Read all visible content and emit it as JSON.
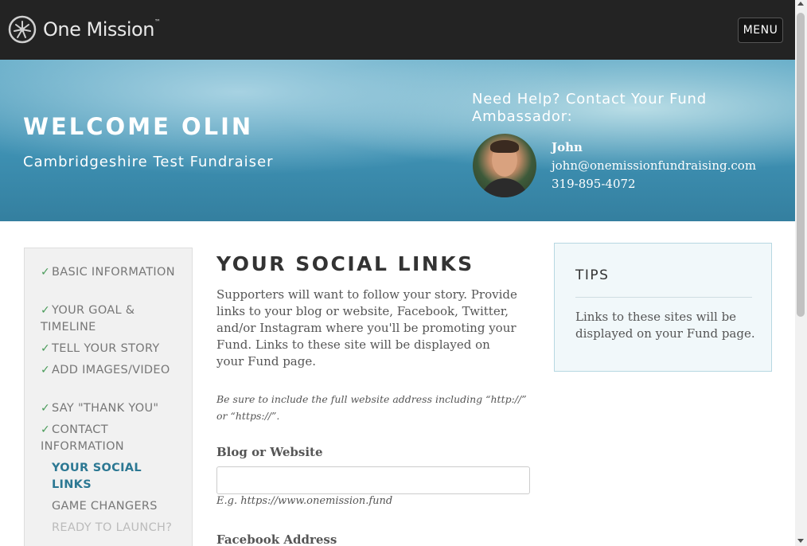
{
  "header": {
    "logo_text": "One Mission",
    "logo_tm": "™",
    "logo_icon": "tree-of-life-icon",
    "menu_label": "MENU"
  },
  "hero": {
    "welcome": "WELCOME OLIN",
    "campaign": "Cambridgeshire Test Fundraiser",
    "help_title": "Need Help? Contact Your Fund Ambassador:",
    "ambassador": {
      "name": "John",
      "email": "john@onemissionfundraising.com",
      "phone": "319-895-4072"
    }
  },
  "sidebar": {
    "steps": [
      {
        "label": "BASIC INFORMATION",
        "status": "done"
      },
      {
        "label": "YOUR GOAL & TIMELINE",
        "status": "done"
      },
      {
        "label": "TELL YOUR STORY",
        "status": "done"
      },
      {
        "label": "ADD IMAGES/VIDEO",
        "status": "done"
      },
      {
        "label": "SAY \"THANK YOU\"",
        "status": "done"
      },
      {
        "label": "CONTACT INFORMATION",
        "status": "done"
      },
      {
        "label": "YOUR SOCIAL LINKS",
        "status": "current"
      },
      {
        "label": "GAME CHANGERS",
        "status": "todo"
      },
      {
        "label": "READY TO LAUNCH?",
        "status": "disabled"
      }
    ],
    "check_glyph": "✓"
  },
  "main": {
    "title": "YOUR SOCIAL LINKS",
    "intro": "Supporters will want to follow your story. Provide links to your blog or website, Facebook, Twitter, and/or Instagram where you'll be promoting your Fund. Links to these site will be displayed on your Fund page.",
    "note": "Be sure to include the full website address including “http://” or “https://”.",
    "fields": {
      "blog": {
        "label": "Blog or Website",
        "value": "",
        "example": "E.g. https://www.onemission.fund"
      },
      "facebook": {
        "label": "Facebook Address"
      }
    }
  },
  "tips": {
    "title": "TIPS",
    "text": "Links to these sites will be displayed on your Fund page."
  },
  "colors": {
    "topbar": "#232323",
    "accent": "#2c7893",
    "check": "#4a9b5a"
  }
}
